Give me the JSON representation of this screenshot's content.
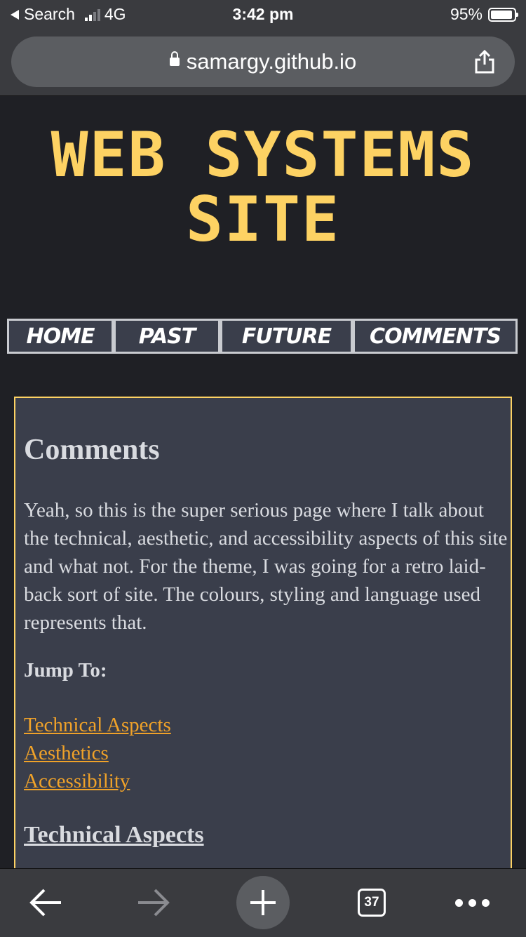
{
  "status_bar": {
    "back_app": "Search",
    "network": "4G",
    "time": "3:42 pm",
    "battery": "95%"
  },
  "url_bar": {
    "url": "samargy.github.io"
  },
  "page": {
    "title_line1": "WEB SYSTEMS",
    "title_line2": "SITE",
    "nav": [
      {
        "label": "HOME"
      },
      {
        "label": "PAST"
      },
      {
        "label": "FUTURE"
      },
      {
        "label": "COMMENTS"
      }
    ],
    "heading": "Comments",
    "intro": "Yeah, so this is the super serious page where I talk about the technical, aesthetic, and accessibility aspects of this site and what not. For the theme, I was going for a retro laid-back sort of site. The colours, styling and language used represents that.",
    "jump_label": "Jump To:",
    "jump_links": [
      {
        "label": "Technical Aspects"
      },
      {
        "label": "Aesthetics"
      },
      {
        "label": "Accessibility"
      }
    ],
    "section_heading": "Technical Aspects"
  },
  "toolbar": {
    "tab_count": "37"
  },
  "colors": {
    "accent_yellow": "#fdd263",
    "link_orange": "#f0a229",
    "panel_bg": "#3a3e4b",
    "page_bg": "#1f2025"
  }
}
